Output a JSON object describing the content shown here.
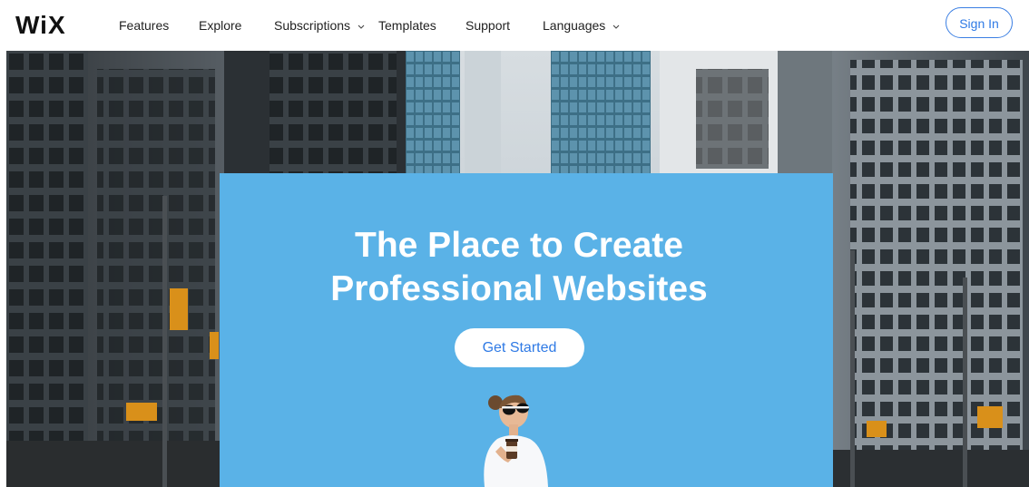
{
  "brand": {
    "logo_text": "WiX",
    "accent": "#2f7ae5",
    "panel_color": "#5ab2e7"
  },
  "header": {
    "nav": [
      {
        "label": "Features"
      },
      {
        "label": "Explore"
      },
      {
        "label": "Subscriptions",
        "has_dropdown": true,
        "icon": "chevron-down-icon"
      },
      {
        "label": "Templates"
      },
      {
        "label": "Support"
      },
      {
        "label": "Languages",
        "has_dropdown": true,
        "icon": "chevron-down-icon"
      }
    ],
    "sign_in_label": "Sign In"
  },
  "hero": {
    "headline_line1": "The Place to Create",
    "headline_line2": "Professional Websites",
    "cta_label": "Get Started"
  }
}
